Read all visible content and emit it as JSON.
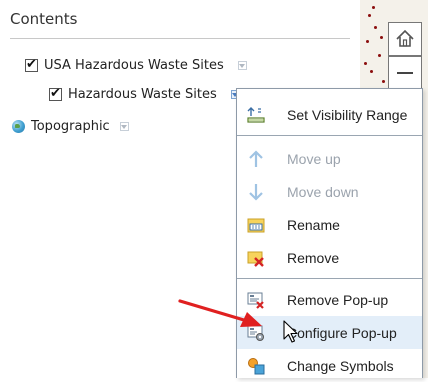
{
  "contents": {
    "title": "Contents",
    "layers": [
      {
        "label": "USA Hazardous Waste Sites",
        "checked": true
      },
      {
        "label": "Hazardous Waste Sites",
        "checked": true
      },
      {
        "label": "Topographic"
      }
    ]
  },
  "menu": {
    "items": [
      {
        "label": "Set Visibility Range",
        "icon": "visibility-range-icon",
        "enabled": true
      },
      {
        "label": "Move up",
        "icon": "arrow-up-icon",
        "enabled": false
      },
      {
        "label": "Move down",
        "icon": "arrow-down-icon",
        "enabled": false
      },
      {
        "label": "Rename",
        "icon": "rename-icon",
        "enabled": true
      },
      {
        "label": "Remove",
        "icon": "remove-icon",
        "enabled": true
      },
      {
        "label": "Remove Pop-up",
        "icon": "remove-popup-icon",
        "enabled": true
      },
      {
        "label": "Configure Pop-up",
        "icon": "configure-popup-icon",
        "enabled": true,
        "hovered": true
      },
      {
        "label": "Change Symbols",
        "icon": "change-symbols-icon",
        "enabled": true
      }
    ]
  },
  "map_controls": {
    "home_icon": "home-icon",
    "zoom_out_icon": "zoom-out-icon"
  },
  "colors": {
    "menu_hover": "#e3eef9",
    "annotation_arrow": "#e02020",
    "map_point": "#8b0e0e"
  }
}
